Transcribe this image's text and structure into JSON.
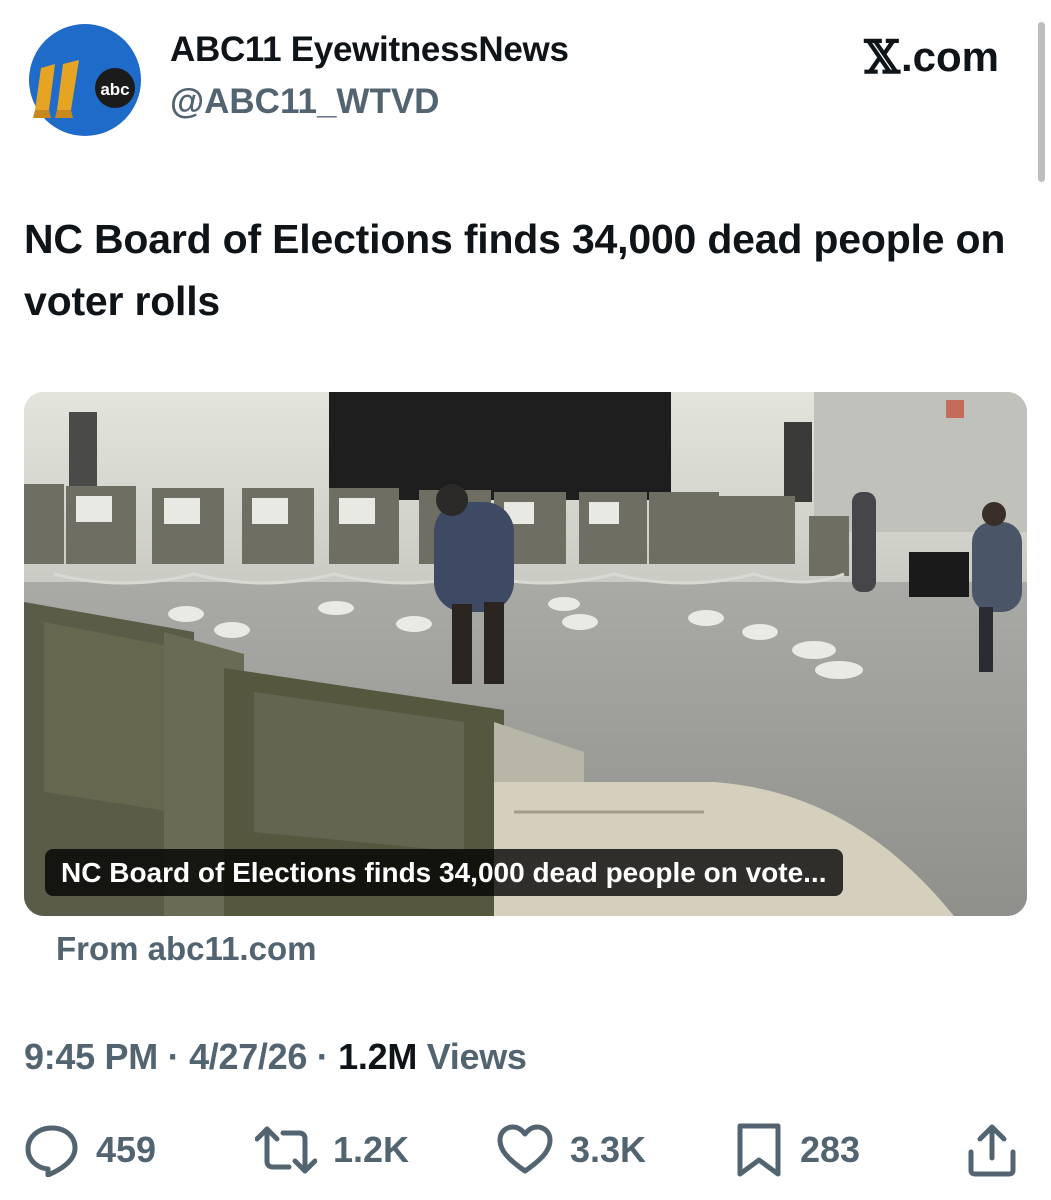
{
  "author": {
    "name": "ABC11 EyewitnessNews",
    "handle": "@ABC11_WTVD",
    "logo_text": "abc"
  },
  "brand": {
    "x_glyph": "𝕏",
    "suffix": ".com"
  },
  "tweet": {
    "text": "NC Board of Elections finds 34,000 dead people on voter rolls"
  },
  "card": {
    "caption": "NC Board of Elections finds 34,000 dead people on vote...",
    "source": "From abc11.com"
  },
  "meta": {
    "time": "9:45 PM",
    "separator": " · ",
    "date": "4/27/26",
    "views_count": "1.2M",
    "views_label": " Views"
  },
  "actions": {
    "replies": "459",
    "reposts": "1.2K",
    "likes": "3.3K",
    "bookmarks": "283"
  },
  "colors": {
    "text": "#0f1419",
    "secondary": "#536471",
    "logo_blue": "#1f6bc9",
    "logo_gold": "#e5a422"
  },
  "icons": [
    "reply-icon",
    "repost-icon",
    "like-icon",
    "bookmark-icon",
    "share-icon"
  ]
}
